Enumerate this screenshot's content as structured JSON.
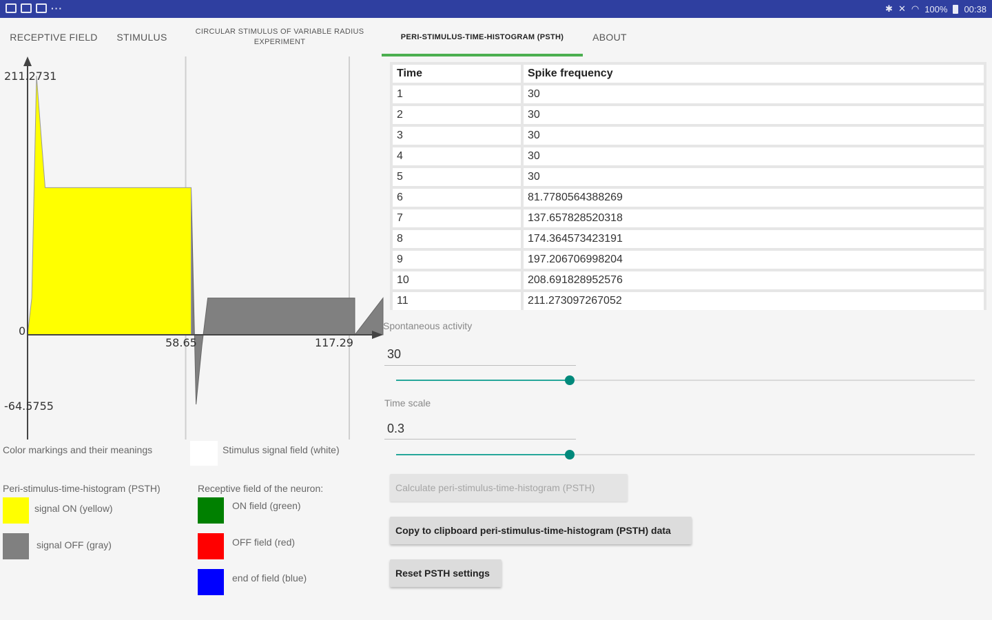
{
  "status_bar": {
    "right_text": "100%",
    "time": "00:38"
  },
  "tabs": [
    {
      "label": "RECEPTIVE FIELD"
    },
    {
      "label": "STIMULUS"
    },
    {
      "label": "CIRCULAR STIMULUS OF VARIABLE RADIUS EXPERIMENT"
    },
    {
      "label": "PERI-STIMULUS-TIME-HISTOGRAM (PSTH)"
    },
    {
      "label": "ABOUT"
    }
  ],
  "chart_data": {
    "type": "area",
    "y_max_label": "211.2731",
    "y_min_label": "-64.5755",
    "origin_label": "0",
    "x_tick_labels": [
      "58.65",
      "117.29"
    ],
    "ylim": [
      -64.5755,
      211.2731
    ],
    "xlim": [
      0,
      117.29
    ],
    "on_signal": {
      "name": "signal ON",
      "color": "#ffff00",
      "x": [
        0,
        1.5,
        3.2,
        6.3,
        58.65
      ],
      "y": [
        0,
        30,
        211.27,
        120,
        120
      ]
    },
    "off_signal": {
      "name": "signal OFF",
      "color": "#808080",
      "x": [
        58.65,
        60.4,
        62.5,
        64.6,
        117.29
      ],
      "y": [
        120,
        -64.58,
        -10,
        30,
        30
      ]
    },
    "gridlines_x": [
      58.65,
      117.29
    ]
  },
  "legend": {
    "title": "Color markings and their meanings",
    "stimulus_field": "Stimulus signal field (white)",
    "psth_title": "Peri-stimulus-time-histogram (PSTH)",
    "rf_title": "Receptive field of the neuron:",
    "items": [
      {
        "label": "signal ON (yellow)",
        "color": "#ffff00"
      },
      {
        "label": "signal OFF (gray)",
        "color": "#808080"
      },
      {
        "label": "ON field (green)",
        "color": "#008000"
      },
      {
        "label": "OFF field (red)",
        "color": "#ff0000"
      },
      {
        "label": "end of field (blue)",
        "color": "#0000ff"
      }
    ]
  },
  "table": {
    "headers": [
      "Time",
      "Spike frequency"
    ],
    "rows": [
      [
        "1",
        "30"
      ],
      [
        "2",
        "30"
      ],
      [
        "3",
        "30"
      ],
      [
        "4",
        "30"
      ],
      [
        "5",
        "30"
      ],
      [
        "6",
        "81.7780564388269"
      ],
      [
        "7",
        "137.657828520318"
      ],
      [
        "8",
        "174.364573423191"
      ],
      [
        "9",
        "197.206706998204"
      ],
      [
        "10",
        "208.691828952576"
      ],
      [
        "11",
        "211.273097267052"
      ]
    ]
  },
  "controls": {
    "spontaneous_label": "Spontaneous activity",
    "spontaneous_value": "30",
    "spontaneous_level": 0.3,
    "timescale_label": "Time scale",
    "timescale_value": "0.3",
    "timescale_level": 0.3
  },
  "buttons": {
    "calculate": "Calculate peri-stimulus-time-histogram (PSTH)",
    "copy": "Copy to clipboard peri-stimulus-time-histogram (PSTH) data",
    "reset": "Reset PSTH settings"
  }
}
